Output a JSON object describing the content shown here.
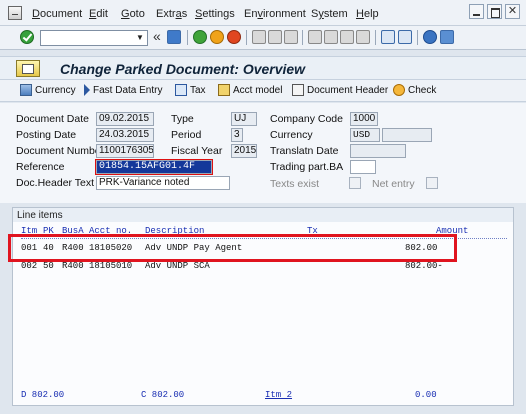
{
  "menu": {
    "items": [
      {
        "label": "Document",
        "ul": "D",
        "rest": "ocument"
      },
      {
        "label": "Edit",
        "ul": "E",
        "rest": "dit"
      },
      {
        "label": "Goto",
        "ul": "G",
        "rest": "oto"
      },
      {
        "label": "Extras",
        "ul": "",
        "rest": "Extr"
      },
      {
        "label": "Settings",
        "ul": "S",
        "rest": "ettings"
      },
      {
        "label": "Environment",
        "ul": "",
        "rest": "Environment"
      },
      {
        "label": "System",
        "ul": "",
        "rest": "System"
      },
      {
        "label": "Help",
        "ul": "H",
        "rest": "elp"
      }
    ],
    "extras_ul": "a",
    "extras_tail": "s",
    "environment_ul": "v",
    "environment_head": "En",
    "environment_tail": "ironment",
    "system_ul": "y",
    "system_head": "S",
    "system_tail": "stem"
  },
  "toolbar": {
    "double_arrow": "«"
  },
  "title": "Change Parked Document: Overview",
  "app_toolbar": {
    "currency": "Currency",
    "fast_data_entry": "Fast Data Entry",
    "tax": "Tax",
    "acct_model": "Acct model",
    "document_header": "Document Header",
    "check": "Check"
  },
  "header": {
    "document_date_label": "Document Date",
    "document_date": "09.02.2015",
    "type_label": "Type",
    "type": "UJ",
    "company_code_label": "Company Code",
    "company_code": "1000",
    "posting_date_label": "Posting Date",
    "posting_date": "24.03.2015",
    "period_label": "Period",
    "period": "3",
    "currency_label": "Currency",
    "currency": "USD",
    "document_number_label": "Document Number",
    "document_number": "1100176305",
    "fiscal_year_label": "Fiscal Year",
    "fiscal_year": "2015",
    "translatn_date_label": "Translatn Date",
    "translatn_date": "",
    "reference_label": "Reference",
    "reference": "01854.15AFG01.4F",
    "trading_part_label": "Trading part.BA",
    "trading_part": "",
    "doc_header_text_label": "Doc.Header Text",
    "doc_header_text": "PRK-Variance noted",
    "texts_exist_label": "Texts exist",
    "net_entry_label": "Net entry"
  },
  "line_items": {
    "caption": "Line items",
    "columns": {
      "itm": "Itm",
      "pk": "PK",
      "busa": "BusA",
      "acct_no": "Acct no.",
      "description": "Description",
      "tx": "Tx",
      "amount": "Amount"
    },
    "rows": [
      {
        "itm": "001",
        "pk": "40",
        "busa": "R400",
        "acct": "18105020",
        "desc": "Adv UNDP Pay Agent",
        "amount": "802.00"
      },
      {
        "itm": "002",
        "pk": "50",
        "busa": "R400",
        "acct": "18105010",
        "desc": "Adv UNDP SCA",
        "amount": "802.00-"
      }
    ],
    "footer": {
      "debit": "D 802.00",
      "credit": "C 802.00",
      "itm": "Itm 2",
      "balance": "0.00"
    }
  }
}
